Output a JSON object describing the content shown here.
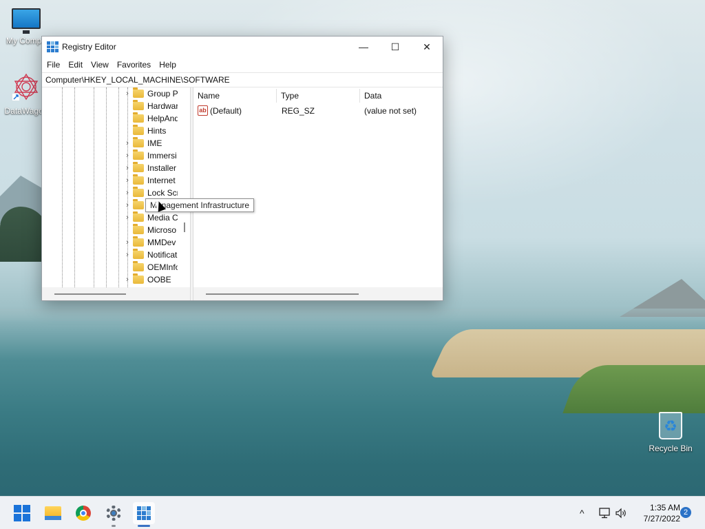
{
  "desktop": {
    "icons": [
      {
        "label": "My Compu",
        "icon": "computer-icon"
      },
      {
        "label": "DataWagon",
        "icon": "datawagon-icon"
      },
      {
        "label": "Recycle Bin",
        "icon": "recycle-bin-icon"
      }
    ]
  },
  "window": {
    "title": "Registry Editor",
    "controls": {
      "minimize": "—",
      "maximize": "☐",
      "close": "✕"
    },
    "menu": [
      "File",
      "Edit",
      "View",
      "Favorites",
      "Help"
    ],
    "address": "Computer\\HKEY_LOCAL_MACHINE\\SOFTWARE"
  },
  "tree": {
    "items": [
      {
        "label": "Group P",
        "expandable": true
      },
      {
        "label": "Hardwar",
        "expandable": false
      },
      {
        "label": "HelpAnd",
        "expandable": false
      },
      {
        "label": "Hints",
        "expandable": false
      },
      {
        "label": "IME",
        "expandable": true
      },
      {
        "label": "Immersi",
        "expandable": true
      },
      {
        "label": "Installer",
        "expandable": true
      },
      {
        "label": "Internet",
        "expandable": true
      },
      {
        "label": "Lock Scr",
        "expandable": true
      },
      {
        "label": "Ma",
        "expandable": true
      },
      {
        "label": "Media C",
        "expandable": true
      },
      {
        "label": "Microso",
        "expandable": false
      },
      {
        "label": "MMDev",
        "expandable": true
      },
      {
        "label": "Notificat",
        "expandable": true
      },
      {
        "label": "OEMInfo",
        "expandable": false
      },
      {
        "label": "OOBE",
        "expandable": true
      }
    ]
  },
  "list": {
    "columns": [
      "Name",
      "Type",
      "Data"
    ],
    "rows": [
      {
        "name": "(Default)",
        "type": "REG_SZ",
        "data": "(value not set)",
        "icon": "string-value-icon"
      }
    ]
  },
  "tooltip": "Management Infrastructure",
  "taskbar": {
    "apps": [
      "start-icon",
      "file-explorer-icon",
      "chrome-icon",
      "settings-icon",
      "registry-editor-icon"
    ],
    "tray": {
      "chevron": "^",
      "time": "1:35 AM",
      "date": "7/27/2022",
      "notifications": "2"
    }
  },
  "colors": {
    "accent": "#1a73d9",
    "folder": "#eab93a"
  }
}
